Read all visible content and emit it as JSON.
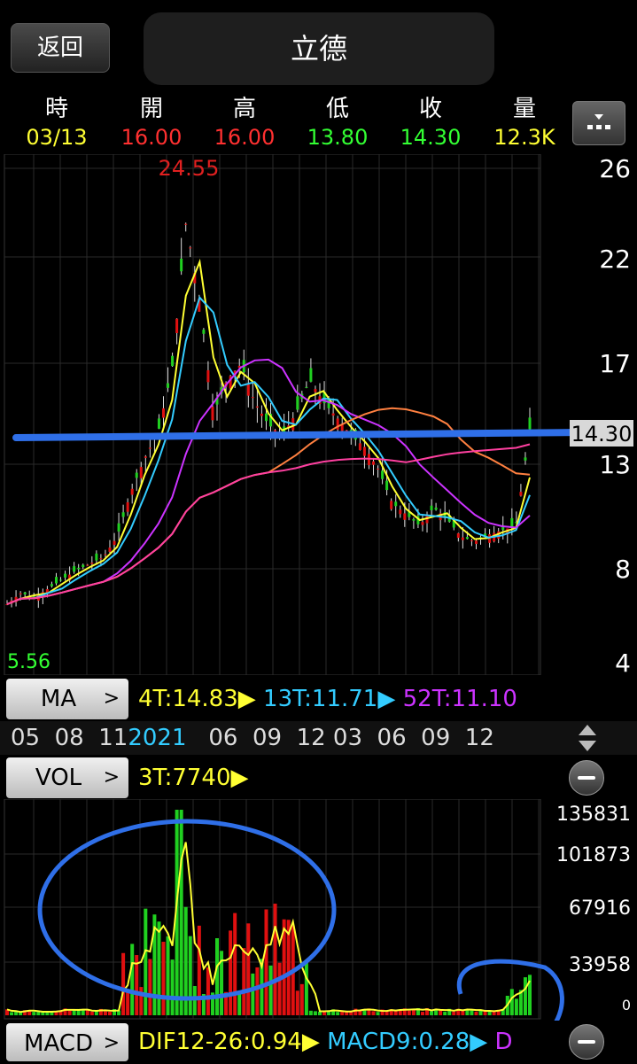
{
  "header": {
    "back_label": "返回",
    "stock_name": "立德"
  },
  "quote": {
    "labels": [
      "時",
      "開",
      "高",
      "低",
      "收",
      "量"
    ],
    "values": [
      "03/13",
      "16.00",
      "16.00",
      "13.80",
      "14.30",
      "12.3K"
    ],
    "colors": [
      "#ffff33",
      "#ff3030",
      "#ff3030",
      "#33ff33",
      "#33ff33",
      "#ffff33"
    ]
  },
  "price_axis": {
    "ticks": [
      "26",
      "22",
      "17",
      "13",
      "8",
      "4"
    ],
    "current_price": "14.30",
    "high_label": "24.55",
    "low_label": "5.56"
  },
  "ma": {
    "button_label": "MA",
    "arrow": ">",
    "items": [
      {
        "text": "4T:14.83",
        "color": "#ffff33"
      },
      {
        "text": "13T:11.71",
        "color": "#33ccff"
      },
      {
        "text": "52T:11.10",
        "color": "#cc33ff"
      }
    ]
  },
  "time_axis": {
    "labels": [
      "05",
      "08",
      "11",
      "2021",
      "06",
      "09",
      "12",
      "03",
      "06",
      "09",
      "12"
    ],
    "highlight": "2021"
  },
  "vol": {
    "button_label": "VOL",
    "arrow": ">",
    "legend": "3T:7740",
    "ticks": [
      "135831",
      "101873",
      "67916",
      "33958",
      "0"
    ]
  },
  "macd": {
    "button_label": "MACD",
    "arrow": ">",
    "items": [
      {
        "text": "DIF12-26:0.94",
        "color": "#ffff33"
      },
      {
        "text": "MACD9:0.28",
        "color": "#33ccff"
      },
      {
        "text": "D",
        "color": "#cc33ff"
      }
    ]
  },
  "colors": {
    "up": "#e01010",
    "down": "#20d020",
    "ma4": "#ffff33",
    "ma13": "#33ccff",
    "ma52": "#cc33ff",
    "ma_long": "#ff8040",
    "ma_long2": "#ff40a0",
    "annotation": "#2f6fe8"
  },
  "chart_data": {
    "type": "candlestick",
    "y_axis_ticks": [
      26,
      22,
      17,
      13,
      8,
      4
    ],
    "close_series": [
      6.5,
      7.0,
      6.8,
      7.2,
      7.6,
      8.0,
      8.3,
      8.6,
      9.5,
      11.5,
      13.0,
      14.2,
      17.0,
      23.5,
      20.0,
      15.0,
      16.5,
      17.2,
      15.5,
      14.5,
      14.0,
      15.0,
      16.5,
      15.5,
      14.8,
      14.0,
      13.5,
      12.5,
      11.0,
      10.5,
      10.0,
      10.8,
      10.3,
      9.5,
      9.3,
      9.6,
      9.8,
      10.0,
      14.3
    ],
    "volume_ticks": [
      135831,
      101873,
      67916,
      33958,
      0
    ]
  }
}
